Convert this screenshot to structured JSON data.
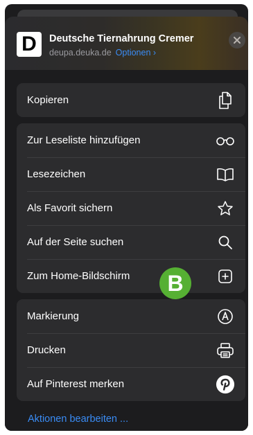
{
  "site": {
    "logo_letter": "D",
    "title": "Deutsche Tiernahrung Cremer",
    "domain": "deupa.deuka.de",
    "options_label": "Optionen ›"
  },
  "groups": [
    {
      "items": [
        {
          "label": "Kopieren",
          "icon": "copy-icon"
        }
      ]
    },
    {
      "items": [
        {
          "label": "Zur Leseliste hinzufügen",
          "icon": "glasses-icon"
        },
        {
          "label": "Lesezeichen",
          "icon": "book-icon"
        },
        {
          "label": "Als Favorit sichern",
          "icon": "star-icon"
        },
        {
          "label": "Auf der Seite suchen",
          "icon": "search-icon"
        },
        {
          "label": "Zum Home-Bildschirm",
          "icon": "add-square-icon"
        }
      ]
    },
    {
      "items": [
        {
          "label": "Markierung",
          "icon": "markup-icon"
        },
        {
          "label": "Drucken",
          "icon": "printer-icon"
        },
        {
          "label": "Auf Pinterest merken",
          "icon": "pinterest-icon"
        }
      ]
    }
  ],
  "edit_actions_label": "Aktionen bearbeiten ...",
  "badge_letter": "B",
  "colors": {
    "accent": "#3a8cf5",
    "badge": "#56b033",
    "row_bg": "#2c2c2e",
    "sheet_bg": "#1c1c1e"
  }
}
